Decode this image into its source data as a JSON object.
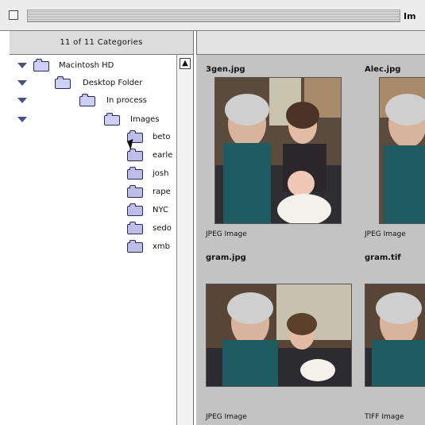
{
  "window": {
    "title": "Im",
    "category_count": "11 of 11 Categories"
  },
  "tree": [
    {
      "label": "Macintosh HD",
      "expanded": true,
      "level": 0
    },
    {
      "label": "Desktop Folder",
      "expanded": true,
      "level": 1
    },
    {
      "label": "In process",
      "expanded": true,
      "level": 2
    },
    {
      "label": "Images",
      "expanded": true,
      "level": 3
    },
    {
      "label": "beto",
      "level": 4
    },
    {
      "label": "earle",
      "level": 4
    },
    {
      "label": "josh",
      "level": 4
    },
    {
      "label": "rape",
      "level": 4
    },
    {
      "label": "NYC",
      "level": 4
    },
    {
      "label": "sedo",
      "level": 4
    },
    {
      "label": "xmb",
      "level": 4
    }
  ],
  "thumbnails": [
    {
      "name": "3gen.jpg",
      "type": "JPEG Image"
    },
    {
      "name": "Alec.jpg",
      "type": "JPEG Image"
    },
    {
      "name": "gram.jpg",
      "type": "JPEG Image"
    },
    {
      "name": "gram.tif",
      "type": "TIFF Image"
    }
  ],
  "colors": {
    "folder": "#bdbde8",
    "disclosure": "#4b4f89",
    "thumbnail_bg": "#c3c3c3"
  }
}
